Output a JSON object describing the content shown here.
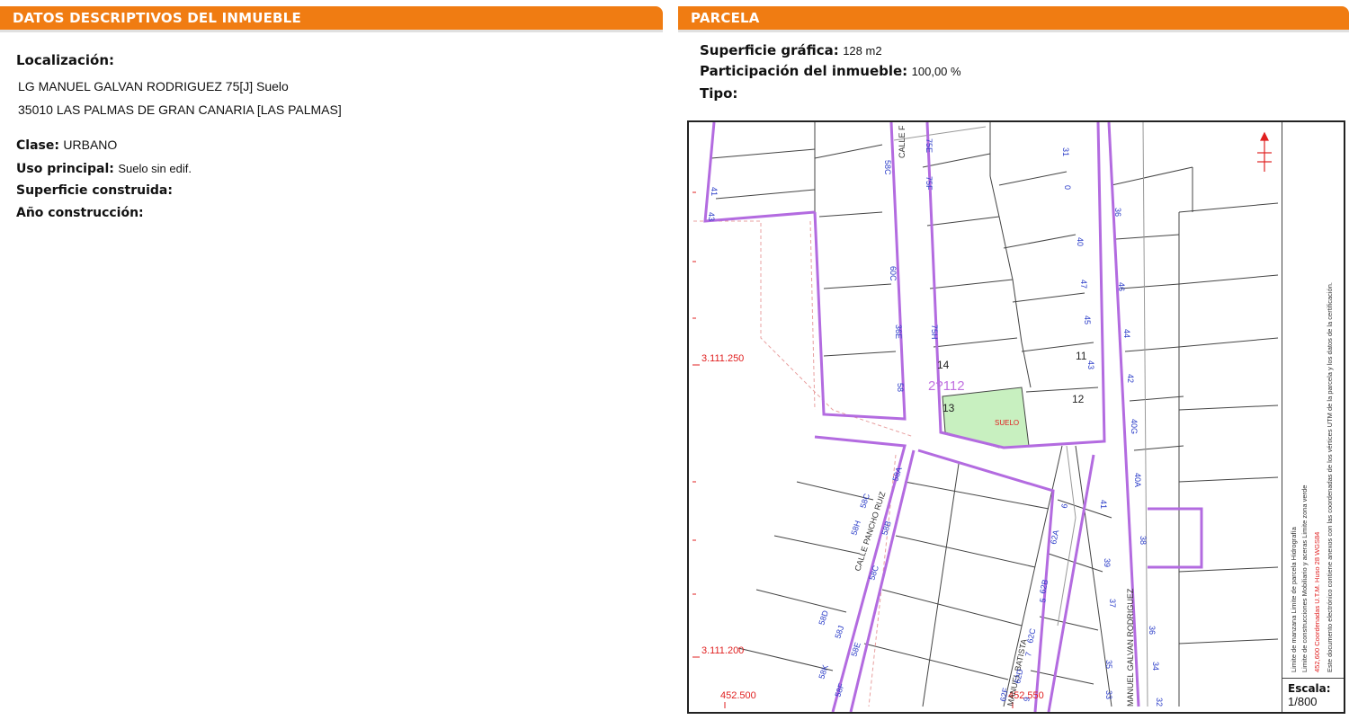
{
  "left": {
    "title_prefix": "DATOS DESCRIPTIVOS DEL ",
    "title_bold": "INMUEBLE",
    "localizacion_label": "Localización:",
    "address_line1": "LG MANUEL GALVAN RODRIGUEZ 75[J] Suelo",
    "address_line2": "35010 LAS PALMAS DE GRAN CANARIA [LAS PALMAS]",
    "clase_label": "Clase:",
    "clase_value": "URBANO",
    "uso_label": "Uso principal:",
    "uso_value": "Suelo sin edif.",
    "superficie_label": "Superficie construida:",
    "anio_label": "Año construcción:"
  },
  "right": {
    "title": "PARCELA",
    "sup_grafica_label": "Superficie gráfica:",
    "sup_grafica_value": "128 m2",
    "participacion_label": "Participación del inmueble:",
    "participacion_value": "100,00 %",
    "tipo_label": "Tipo:"
  },
  "map": {
    "coord_y1": "3.111.250",
    "coord_y2": "3.111.200",
    "coord_x1": "452.500",
    "coord_x2": "452.550",
    "parcel_label": "SUELO",
    "block_ref": "2?112",
    "parcel_numbers": [
      "14",
      "11",
      "13",
      "12"
    ],
    "street_1": "CALLE PANCHO RUIZ",
    "street_2": "MANUEL BATISTA",
    "street_3": "MANUEL GALVAN RODRIGUEZ",
    "street_4": "CALLE F",
    "house_numbers": [
      "41",
      "43",
      "58C",
      "75F",
      "75E",
      "31",
      "0",
      "60C",
      "40",
      "47",
      "45",
      "44",
      "43",
      "42",
      "36",
      "46",
      "38",
      "75H",
      "36E",
      "58",
      "40G",
      "40A",
      "58C",
      "58A",
      "58H",
      "58B",
      "58D",
      "58C",
      "62A",
      "62B",
      "62C",
      "62D",
      "6",
      "5",
      "7",
      "9",
      "41",
      "39",
      "37",
      "35",
      "33",
      "36",
      "34",
      "32",
      "58J",
      "58K",
      "58E",
      "58F",
      "62F"
    ],
    "scale_label": "Escala:",
    "scale_value": "1/800",
    "legend_1": "Limite de manzana   Limite de parcela   Hidrografía",
    "legend_2": "Limite de construcciones   Mobiliario y aceras   Limite zona verde",
    "legend_3": "452,600 Coordenadas U.T.M. Huso 28 WGS84",
    "legend_4": "Este documento electrónico contiene anexos con las coordenadas de los vértices UTM de la parcela y los datos de la certificación."
  },
  "colors": {
    "header": "#f07c12",
    "parcel_fill": "#c8f0c0",
    "block_line": "#b36be0",
    "coord_red": "#e02020",
    "house_blue": "#2a3cc8"
  }
}
